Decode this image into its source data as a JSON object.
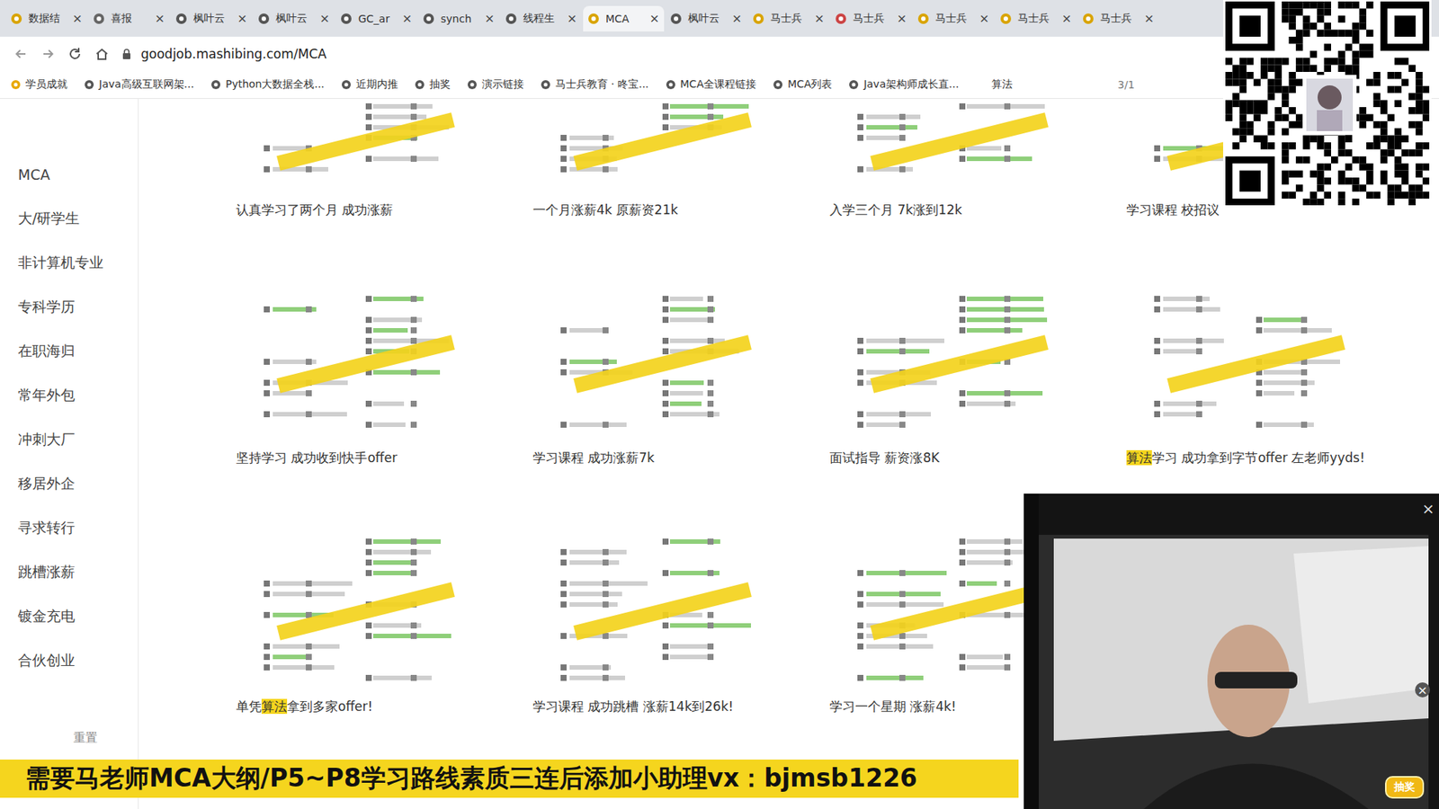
{
  "tabs": [
    {
      "label": "数据结",
      "selected": false,
      "close": "×"
    },
    {
      "label": "喜报",
      "selected": false,
      "close": "×"
    },
    {
      "label": "枫叶云",
      "selected": false,
      "close": "×"
    },
    {
      "label": "枫叶云",
      "selected": false,
      "close": "×"
    },
    {
      "label": "GC_ar",
      "selected": false,
      "close": "×"
    },
    {
      "label": "synch",
      "selected": false,
      "close": "×"
    },
    {
      "label": "线程生",
      "selected": false,
      "close": "×"
    },
    {
      "label": "MCA",
      "selected": true,
      "close": "×"
    },
    {
      "label": "枫叶云",
      "selected": false,
      "close": "×"
    },
    {
      "label": "马士兵",
      "selected": false,
      "close": "×"
    },
    {
      "label": "马士兵",
      "selected": false,
      "close": "×"
    },
    {
      "label": "马士兵",
      "selected": false,
      "close": "×"
    },
    {
      "label": "马士兵",
      "selected": false,
      "close": "×"
    },
    {
      "label": "马士兵",
      "selected": false,
      "close": "×"
    }
  ],
  "toolbar": {
    "url": "goodjob.mashibing.com/MCA"
  },
  "bookmarks": [
    "学员成就",
    "Java高级互联网架...",
    "Python大数据全栈...",
    "近期内推",
    "抽奖",
    "演示链接",
    "马士兵教育 · 咚宝...",
    "MCA全课程链接",
    "MCA列表",
    "Java架构师成长直..."
  ],
  "find": {
    "query": "算法",
    "count": "3/1"
  },
  "sidebar": {
    "items": [
      "MCA",
      "大/研学生",
      "非计算机专业",
      "专科学历",
      "在职海归",
      "常年外包",
      "冲刺大厂",
      "移居外企",
      "寻求转行",
      "跳槽涨薪",
      "镀金充电",
      "合伙创业"
    ],
    "reset": "重置"
  },
  "cards": [
    {
      "caption": [
        {
          "text": "认真学习了两个月 成功涨薪",
          "highlighted": false
        }
      ]
    },
    {
      "caption": [
        {
          "text": "一个月涨薪4k 原薪资21k",
          "highlighted": false
        }
      ]
    },
    {
      "caption": [
        {
          "text": "入学三个月 7k涨到12k",
          "highlighted": false
        }
      ]
    },
    {
      "caption": [
        {
          "text": "学习课程 校招议",
          "highlighted": false
        }
      ]
    },
    {
      "caption": [
        {
          "text": "坚持学习 成功收到快手offer",
          "highlighted": false
        }
      ]
    },
    {
      "caption": [
        {
          "text": "学习课程 成功涨薪7k",
          "highlighted": false
        }
      ]
    },
    {
      "caption": [
        {
          "text": "面试指导 薪资涨8K",
          "highlighted": false
        }
      ]
    },
    {
      "caption": [
        {
          "text": "算法",
          "highlighted": true
        },
        {
          "text": "学习 成功拿到字节offer 左老师yyds!",
          "highlighted": false
        }
      ]
    },
    {
      "caption": [
        {
          "text": "单凭",
          "highlighted": false
        },
        {
          "text": "算法",
          "highlighted": true
        },
        {
          "text": "拿到多家offer!",
          "highlighted": false
        }
      ]
    },
    {
      "caption": [
        {
          "text": "学习课程 成功跳槽 涨薪14k到26k!",
          "highlighted": false
        }
      ]
    },
    {
      "caption": [
        {
          "text": "学习一个星期 涨薪4k!",
          "highlighted": false
        }
      ]
    }
  ],
  "banner": {
    "text": "需要马老师MCA大纲/P5~P8学习路线素质三连后添加小助理vx：bjmsb1226"
  },
  "video": {
    "close": "×",
    "badge_close": "×",
    "badge": "抽奖"
  }
}
